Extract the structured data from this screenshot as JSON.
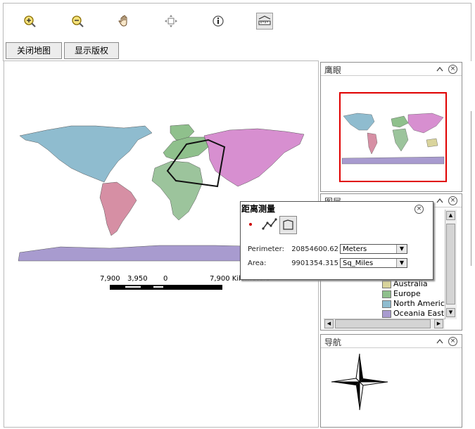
{
  "toolbar": {
    "tools": [
      {
        "name": "zoom-in",
        "icon": "zoom-in-icon"
      },
      {
        "name": "zoom-out",
        "icon": "zoom-out-icon"
      },
      {
        "name": "pan",
        "icon": "hand-icon"
      },
      {
        "name": "full-extent",
        "icon": "full-extent-icon"
      },
      {
        "name": "identify",
        "icon": "info-icon"
      },
      {
        "name": "measure",
        "icon": "measure-icon"
      }
    ],
    "close_map_label": "关闭地图",
    "show_copyright_label": "显示版权"
  },
  "scale": {
    "labels": [
      "7,900",
      "3,950",
      "0",
      "7,900 Kilometers"
    ]
  },
  "overview_panel": {
    "title": "鹰眼"
  },
  "layers_panel": {
    "title": "图层",
    "legend": [
      {
        "label": "Australia",
        "color": "#d9d49c"
      },
      {
        "label": "Europe",
        "color": "#8fc08c"
      },
      {
        "label": "North Americ",
        "color": "#8fbccf"
      },
      {
        "label": "Oceania East",
        "color": "#a89bcf"
      }
    ]
  },
  "nav_panel": {
    "title": "导航"
  },
  "measure_dialog": {
    "title": "距离测量",
    "perimeter_label": "Perimeter:",
    "perimeter_value": "20854600.62",
    "perimeter_unit": "Meters",
    "area_label": "Area:",
    "area_value": "9901354.315",
    "area_unit": "Sq_Miles"
  },
  "colors": {
    "north_america": "#8fbccf",
    "south_america": "#d68fa4",
    "europe": "#8fc08c",
    "africa": "#9cc49c",
    "asia": "#d78fd0",
    "antarctica": "#a89bcf",
    "australia": "#d9d49c",
    "overview_frame": "#e00000"
  }
}
